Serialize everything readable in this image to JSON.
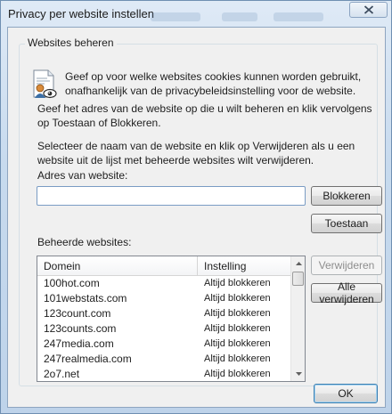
{
  "window": {
    "title": "Privacy per website instellen",
    "close_icon": "close-icon"
  },
  "group": {
    "legend": "Websites beheren"
  },
  "intro": {
    "icon": "privacy-info-icon",
    "text": "Geef op voor welke websites cookies kunnen worden gebruikt, onafhankelijk van de privacybeleidsinstelling voor de website."
  },
  "instructions": {
    "enter_address": "Geef het adres van de website op die u wilt beheren en klik vervolgens op Toestaan of Blokkeren.",
    "select_remove": "Selecteer de naam van de website en klik op Verwijderen als u een website uit de lijst met beheerde websites wilt verwijderen."
  },
  "address": {
    "label": "Adres van website:",
    "value": "",
    "placeholder": ""
  },
  "buttons": {
    "block": "Blokkeren",
    "allow": "Toestaan",
    "remove": "Verwijderen",
    "remove_all": "Alle verwijderen",
    "ok": "OK"
  },
  "managed": {
    "label": "Beheerde websites:",
    "columns": [
      "Domein",
      "Instelling"
    ],
    "rows": [
      {
        "domain": "100hot.com",
        "setting": "Altijd blokkeren"
      },
      {
        "domain": "101webstats.com",
        "setting": "Altijd blokkeren"
      },
      {
        "domain": "123count.com",
        "setting": "Altijd blokkeren"
      },
      {
        "domain": "123counts.com",
        "setting": "Altijd blokkeren"
      },
      {
        "domain": "247media.com",
        "setting": "Altijd blokkeren"
      },
      {
        "domain": "247realmedia.com",
        "setting": "Altijd blokkeren"
      },
      {
        "domain": "2o7.net",
        "setting": "Altijd blokkeren"
      }
    ]
  }
}
